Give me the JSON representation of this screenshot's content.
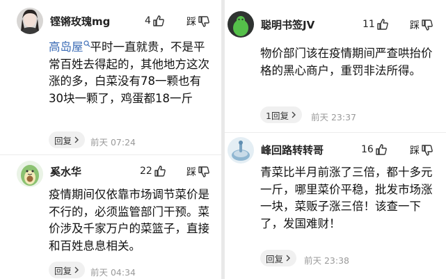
{
  "left_column": {
    "comments": [
      {
        "username": "铿锵玫瑰mg",
        "likes": "4",
        "dislike_label": "踩",
        "link_text": "高岛屋",
        "text_after_link": "平时一直就贵，不是平常百姓去得起的，其他地方这次涨的多，白菜没有78一颗也有30块一颗了，鸡蛋都18一斤",
        "reply_label": "回复",
        "timestamp": "前天 07:24"
      },
      {
        "username": "奚水华",
        "likes": "22",
        "dislike_label": "踩",
        "text": "疫情期间仅依靠市场调节菜价是不行的，必须监管部门干预。菜价涉及千家万户的菜篮子，直接和百姓息息相关。",
        "reply_label": "回复",
        "timestamp": "前天 04:34"
      }
    ]
  },
  "right_column": {
    "comments": [
      {
        "username": "聪明书签JV",
        "likes": "11",
        "dislike_label": "踩",
        "text": "物价部门该在疫情期间严查哄抬价格的黑心商户，重罚非法所得。",
        "reply_label": "1回复",
        "timestamp": "前天 23:37"
      },
      {
        "username": "峰回路转转哥",
        "likes": "16",
        "dislike_label": "踩",
        "text": "青菜比半月前涨了三倍，都十多元一斤，哪里菜价平稳，批发市场涨一块，菜贩子涨三倍！该查一下了，发国难财！",
        "reply_label": "回复",
        "timestamp": "前天 23:38"
      }
    ]
  },
  "icons": {
    "like": "thumbs-up-icon",
    "dislike": "thumbs-down-icon",
    "search": "search-icon",
    "reply_chevron": "chevron-right-icon"
  },
  "colors": {
    "link": "#3a6bb5",
    "timestamp": "#9a9a9a",
    "reply_bg": "#f0f0f0",
    "background": "#e9e9e9"
  }
}
